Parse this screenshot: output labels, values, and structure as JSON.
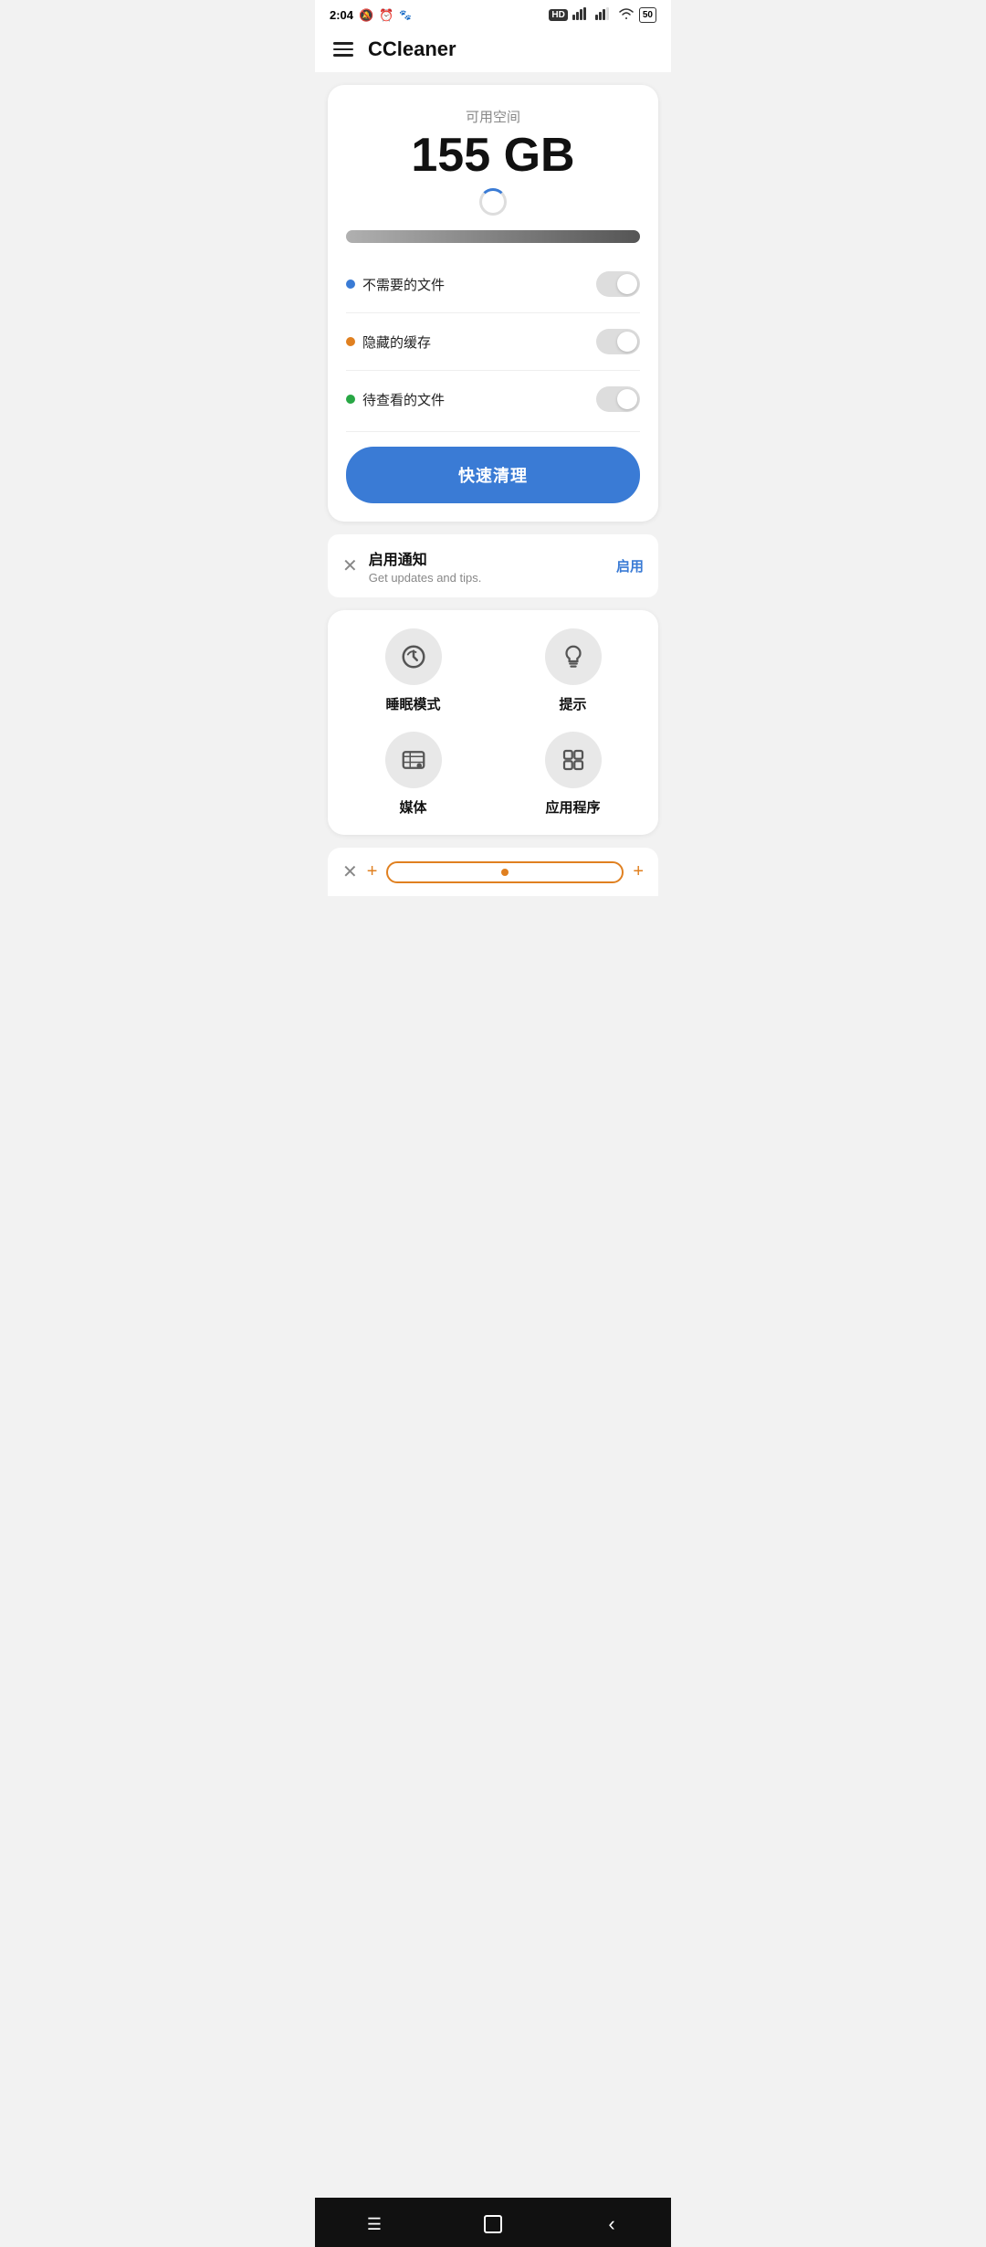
{
  "statusBar": {
    "time": "2:04",
    "battery": "50"
  },
  "header": {
    "title": "CCleaner"
  },
  "storage": {
    "label": "可用空间",
    "value": "155 GB"
  },
  "toggleItems": [
    {
      "label": "不需要的文件",
      "dotClass": "dot-blue",
      "enabled": false
    },
    {
      "label": "隐藏的缓存",
      "dotClass": "dot-orange",
      "enabled": false
    },
    {
      "label": "待查看的文件",
      "dotClass": "dot-green",
      "enabled": false
    }
  ],
  "cleanButton": {
    "label": "快速清理"
  },
  "notification": {
    "title": "启用通知",
    "subtitle": "Get updates and tips.",
    "enableLabel": "启用"
  },
  "features": [
    {
      "label": "睡眠模式",
      "icon": "sleep"
    },
    {
      "label": "提示",
      "icon": "lightbulb"
    },
    {
      "label": "媒体",
      "icon": "media"
    },
    {
      "label": "应用程序",
      "icon": "apps"
    }
  ]
}
